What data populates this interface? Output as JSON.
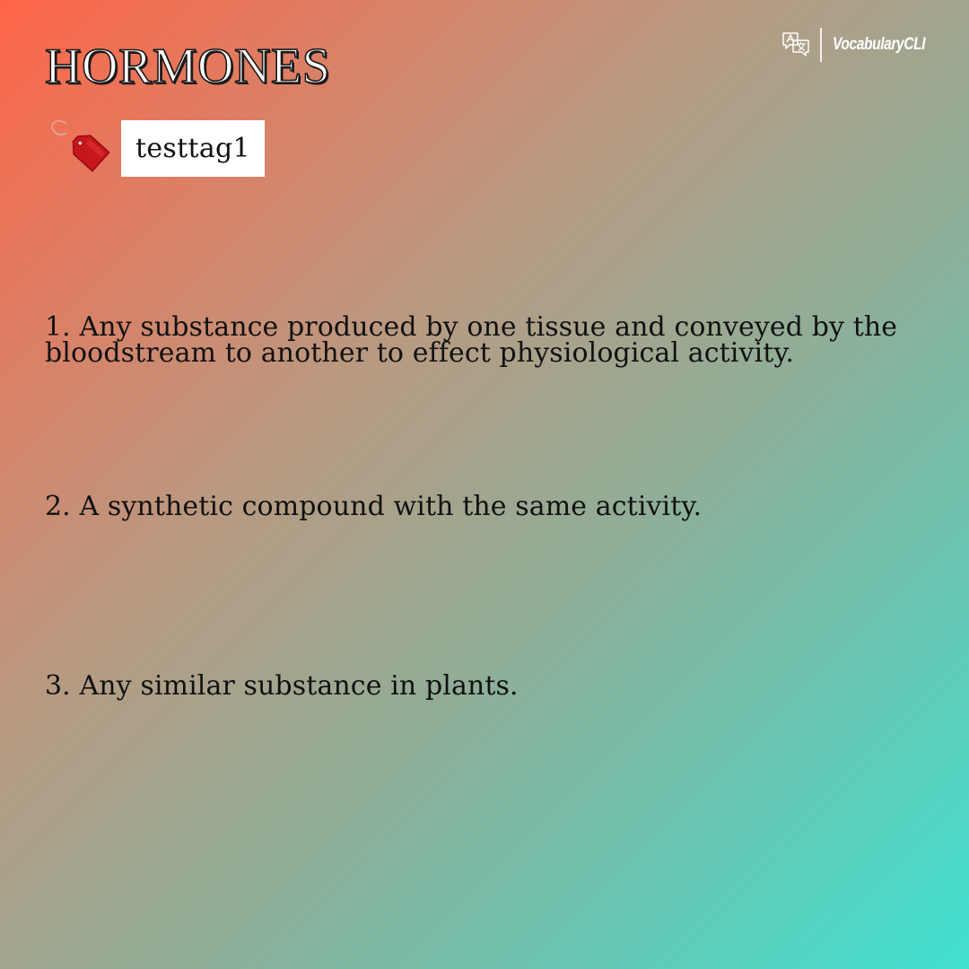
{
  "word": "HORMONES",
  "tag": {
    "label": "testtag1",
    "icon": "price-tag-icon",
    "icon_color": "#c8161d"
  },
  "brand": {
    "name": "VocabularyCLI",
    "icon": "translate-icon"
  },
  "definitions": [
    "1. Any substance produced by one tissue and conveyed by the bloodstream to another to effect physiological activity.",
    "2. A synthetic compound with the same activity.",
    "3. Any similar substance in plants."
  ],
  "colors": {
    "gradient_start": "#ff6548",
    "gradient_end": "#40e0d0",
    "text": "#111111",
    "title_fill": "#ffffff"
  }
}
